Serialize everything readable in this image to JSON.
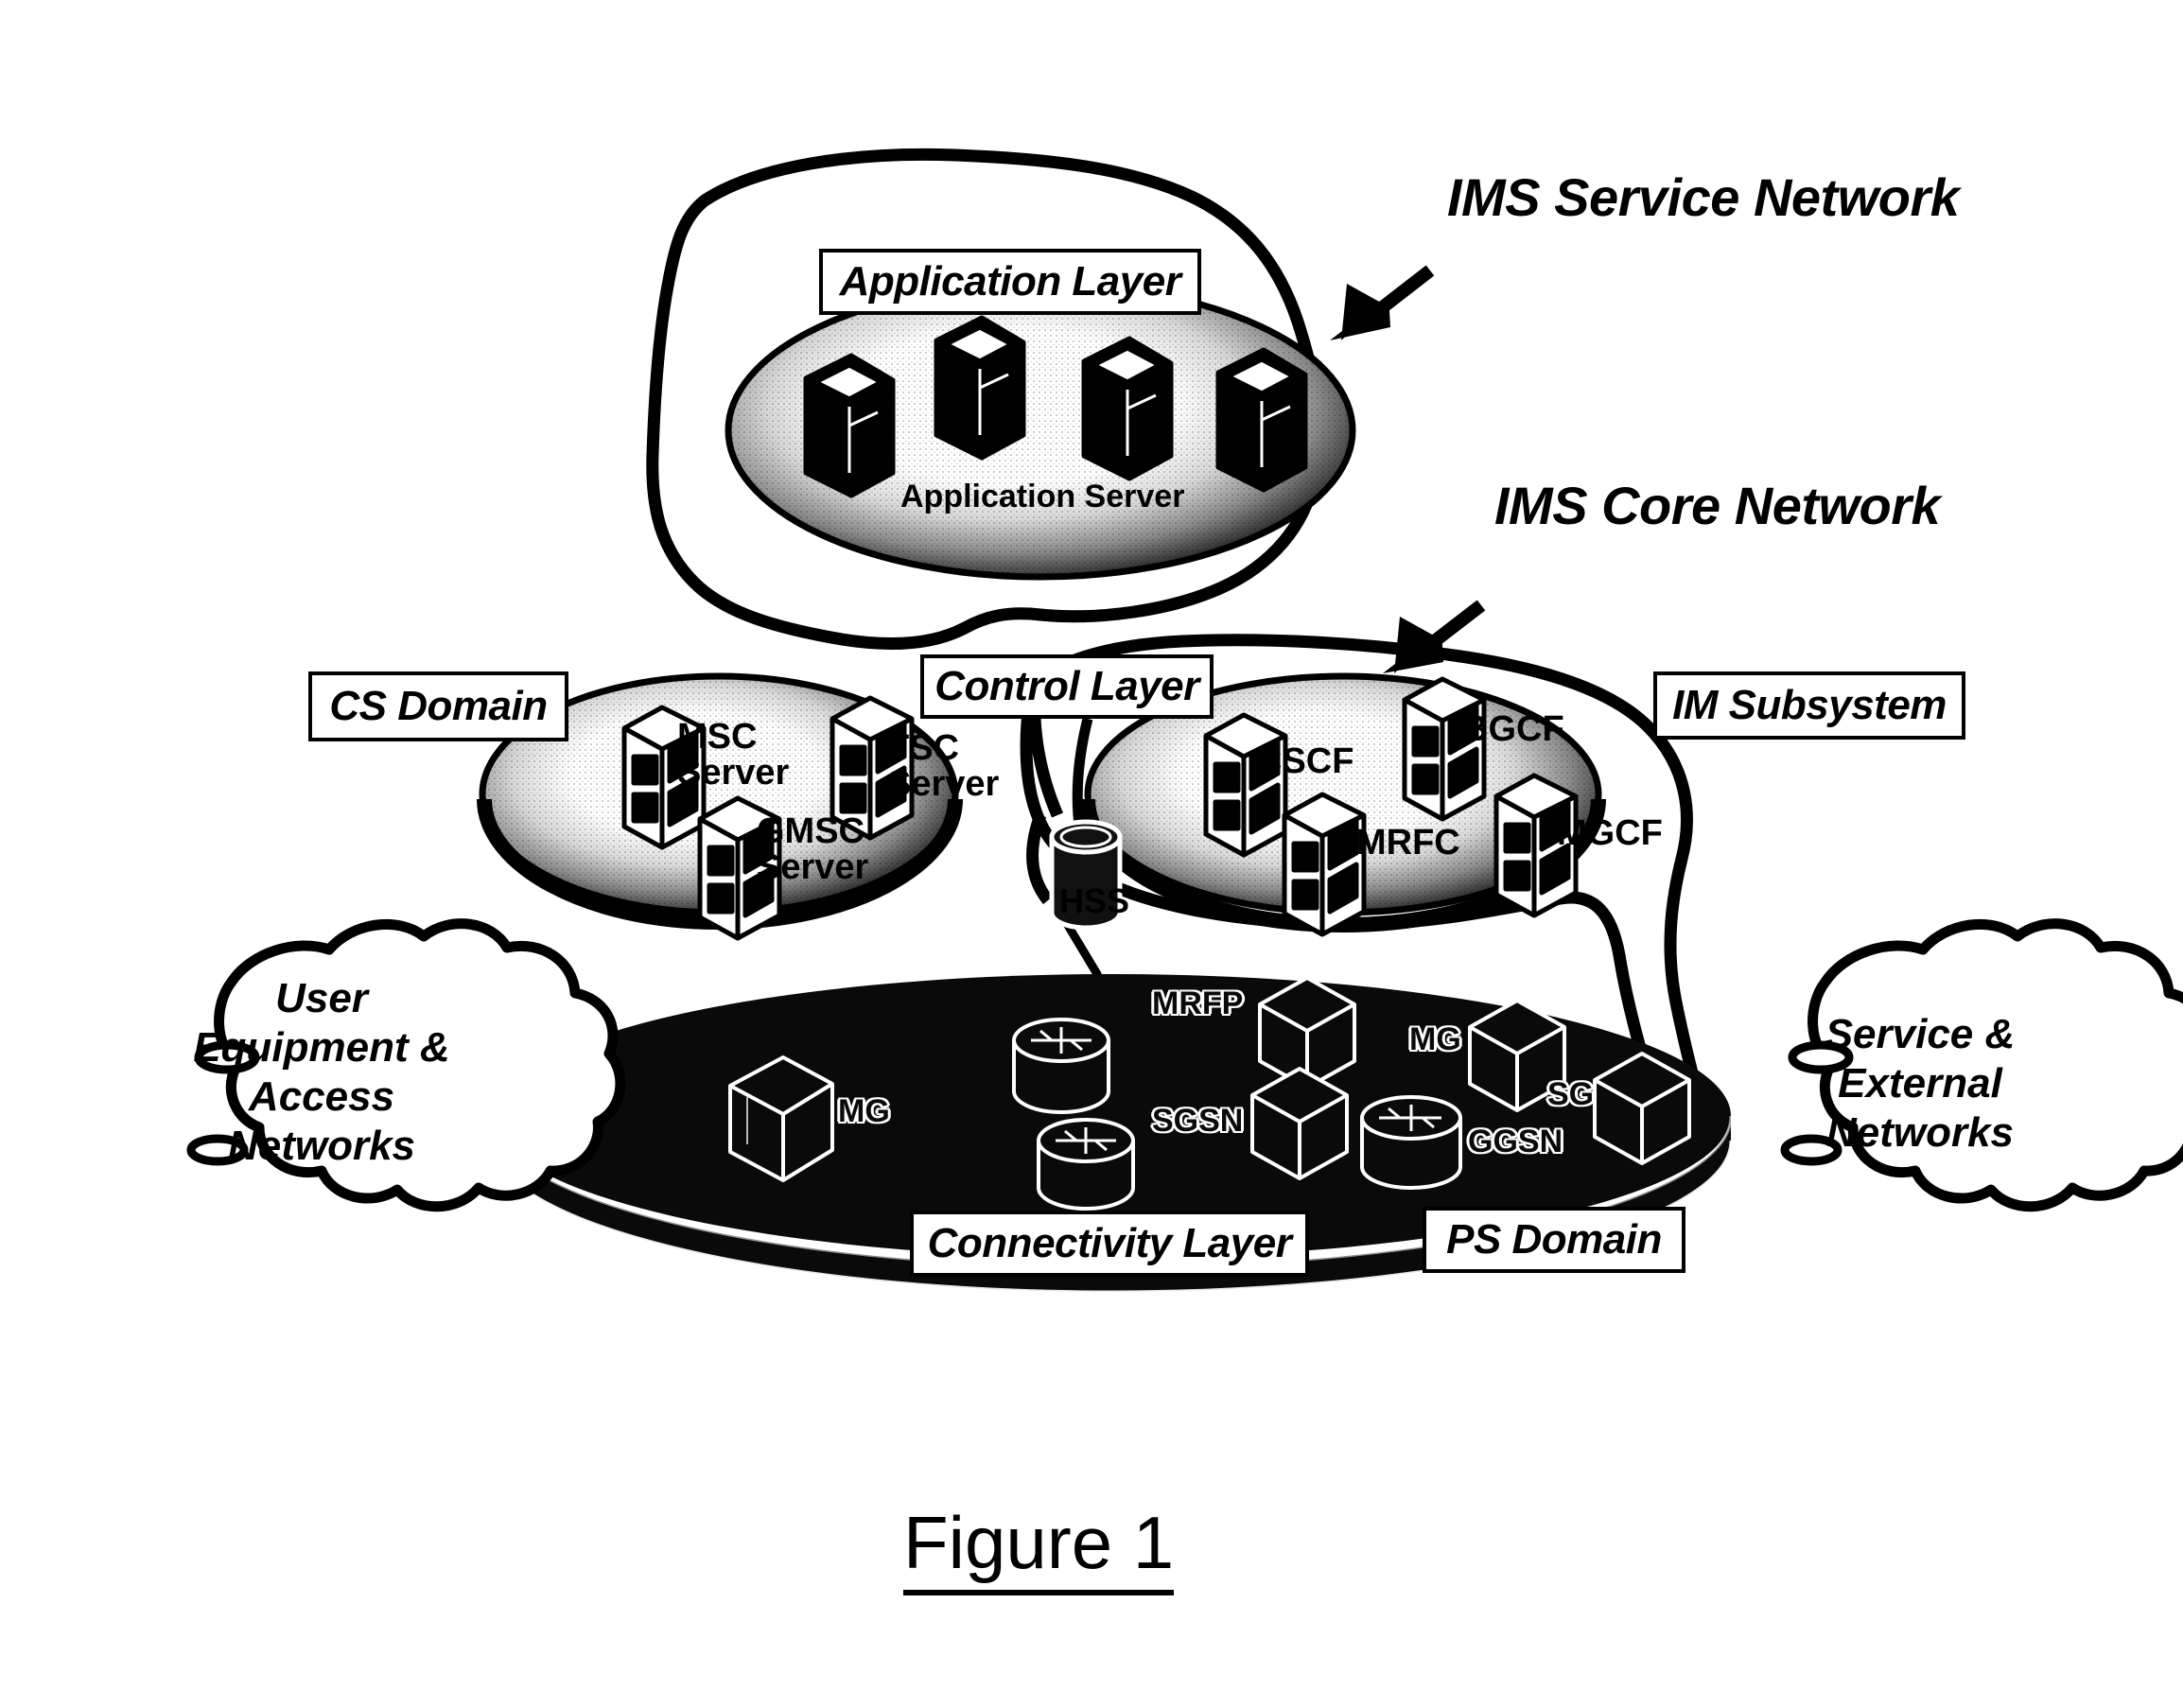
{
  "figure": {
    "caption": "Figure 1"
  },
  "callouts": [
    {
      "name": "ims-service-network",
      "text": "IMS Service Network"
    },
    {
      "name": "ims-core-network",
      "text": "IMS Core Network"
    }
  ],
  "boxed_labels": [
    {
      "name": "application-layer",
      "text": "Application Layer"
    },
    {
      "name": "cs-domain",
      "text": "CS Domain"
    },
    {
      "name": "control-layer",
      "text": "Control Layer"
    },
    {
      "name": "im-subsystem",
      "text": "IM Subsystem"
    },
    {
      "name": "connectivity-layer",
      "text": "Connectivity Layer"
    },
    {
      "name": "ps-domain",
      "text": "PS Domain"
    }
  ],
  "application_layer": {
    "ellipse_label": "Application Server",
    "node_count": 4
  },
  "cs_domain": {
    "nodes": [
      {
        "name": "msc-server",
        "label": "MSC\nServer"
      },
      {
        "name": "tsc-server",
        "label": "TSC\nServer"
      },
      {
        "name": "gmsc-server",
        "label": "GMSC\nServer"
      }
    ]
  },
  "im_subsystem": {
    "nodes": [
      {
        "name": "cscf",
        "label": "CSCF"
      },
      {
        "name": "bgcf",
        "label": "BGCF"
      },
      {
        "name": "mrfc",
        "label": "MRFC"
      },
      {
        "name": "mgcf",
        "label": "MGCF"
      }
    ]
  },
  "control_layer": {
    "hss": {
      "name": "hss",
      "label": "HSS"
    }
  },
  "connectivity_layer": {
    "nodes": [
      {
        "name": "mg-left",
        "label": "MG"
      },
      {
        "name": "mrfp",
        "label": "MRFP"
      },
      {
        "name": "sgsn",
        "label": "SGSN"
      },
      {
        "name": "ggsn",
        "label": "GGSN"
      },
      {
        "name": "mg-right",
        "label": "MG"
      },
      {
        "name": "sg",
        "label": "SG"
      }
    ]
  },
  "clouds": [
    {
      "name": "user-equipment-access-networks",
      "lines": [
        "User",
        "Equipment &",
        "Access",
        "Networks"
      ]
    },
    {
      "name": "service-external-networks",
      "lines": [
        "Service &",
        "External",
        "Networks"
      ]
    }
  ],
  "colors": {
    "ink": "#000000",
    "paper": "#ffffff",
    "ellipse_dark": "#111111"
  }
}
